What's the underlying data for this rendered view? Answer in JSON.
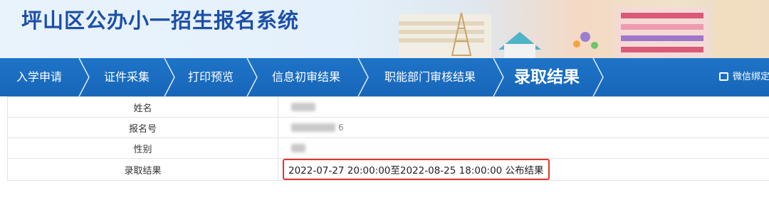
{
  "header": {
    "title": "坪山区公办小一招生报名系统"
  },
  "nav": {
    "items": [
      {
        "label": "入学申请",
        "active": false
      },
      {
        "label": "证件采集",
        "active": false
      },
      {
        "label": "打印预览",
        "active": false
      },
      {
        "label": "信息初审结果",
        "active": false
      },
      {
        "label": "职能部门审核结果",
        "active": false
      },
      {
        "label": "录取结果",
        "active": true
      }
    ],
    "wechat_label": "微信绑定"
  },
  "info": {
    "rows": [
      {
        "label": "姓名",
        "value": ""
      },
      {
        "label": "报名号",
        "value": "",
        "visible_suffix": "6"
      },
      {
        "label": "性别",
        "value": ""
      },
      {
        "label": "录取结果",
        "value": "2022-07-27 20:00:00至2022-08-25 18:00:00 公布结果"
      }
    ]
  },
  "colors": {
    "nav_bg": "#1b6dc1",
    "title": "#1c4fa8",
    "highlight_border": "#e0362c"
  }
}
